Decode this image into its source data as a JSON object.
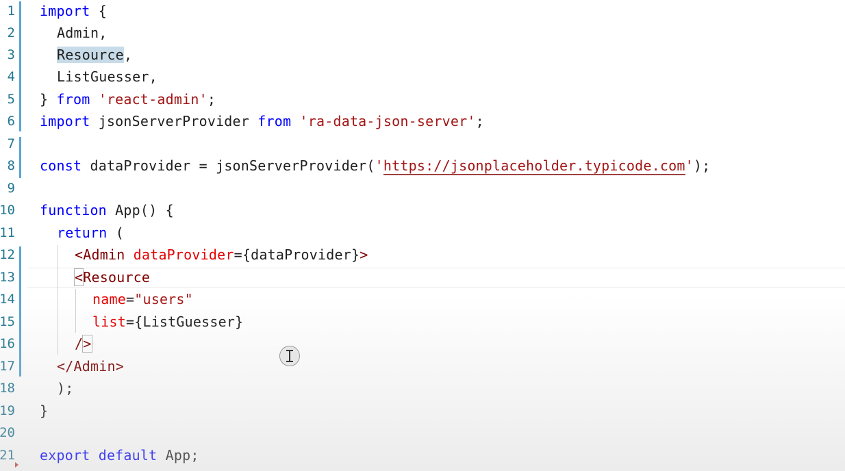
{
  "editor": {
    "line_numbers": [
      "1",
      "2",
      "3",
      "4",
      "5",
      "6",
      "7",
      "8",
      "9",
      "10",
      "11",
      "12",
      "13",
      "14",
      "15",
      "16",
      "17",
      "18",
      "19",
      "20",
      "21"
    ],
    "lines": {
      "l1": {
        "kw": "import",
        "rest": " {"
      },
      "l2": {
        "text": "Admin,"
      },
      "l3": {
        "word": "Resource",
        "rest": ","
      },
      "l4": {
        "text": "ListGuesser,"
      },
      "l5": {
        "pre": "} ",
        "kw": "from",
        "sp": " ",
        "str": "'react-admin'",
        "rest": ";"
      },
      "l6": {
        "kw1": "import",
        "mid": " jsonServerProvider ",
        "kw2": "from",
        "sp": " ",
        "str": "'ra-data-json-server'",
        "rest": ";"
      },
      "l8": {
        "kw": "const",
        "mid": " dataProvider = jsonServerProvider(",
        "q1": "'",
        "url": "https://jsonplaceholder.typicode.com",
        "q2": "'",
        "rest": ");"
      },
      "l10": {
        "kw": "function",
        "rest": " App() {"
      },
      "l11": {
        "kw": "return",
        "rest": " ("
      },
      "l12": {
        "open": "<",
        "tag": "Admin",
        "sp": " ",
        "attr": "dataProvider",
        "rest": "={dataProvider}",
        "close": ">"
      },
      "l13": {
        "open": "<",
        "tag": "Resource"
      },
      "l14": {
        "attr": "name",
        "eq": "=",
        "str": "\"users\""
      },
      "l15": {
        "attr": "list",
        "rest": "={ListGuesser}"
      },
      "l16": {
        "slash": "/",
        "close": ">"
      },
      "l17": {
        "open": "</",
        "tag": "Admin",
        "close": ">"
      },
      "l18": {
        "text": ");"
      },
      "l19": {
        "text": "}"
      },
      "l21": {
        "kw1": "export",
        "sp": " ",
        "kw2": "default",
        "rest": " App;"
      }
    }
  },
  "colors": {
    "keyword": "#0000ff",
    "string": "#a31515",
    "attribute": "#e50000",
    "tag": "#800000",
    "line_number": "#237893",
    "change_marker": "#5ba4d4"
  },
  "icons": {
    "cursor": "text-cursor-icon",
    "fold": "fold-arrow-icon"
  }
}
